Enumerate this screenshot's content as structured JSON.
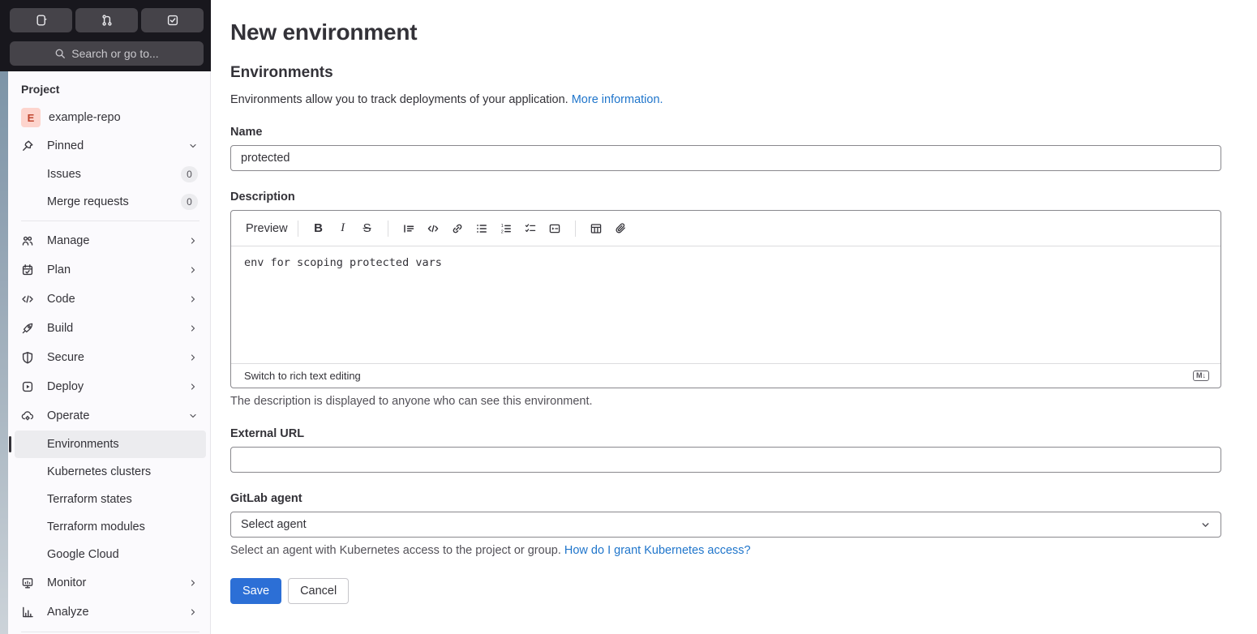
{
  "sidebar": {
    "search_placeholder": "Search or go to...",
    "section_label": "Project",
    "project": {
      "avatar_letter": "E",
      "name": "example-repo"
    },
    "items": [
      {
        "label": "Pinned"
      },
      {
        "label": "Issues",
        "badge": "0"
      },
      {
        "label": "Merge requests",
        "badge": "0"
      },
      {
        "label": "Manage"
      },
      {
        "label": "Plan"
      },
      {
        "label": "Code"
      },
      {
        "label": "Build"
      },
      {
        "label": "Secure"
      },
      {
        "label": "Deploy"
      },
      {
        "label": "Operate"
      },
      {
        "label": "Environments",
        "active": true
      },
      {
        "label": "Kubernetes clusters"
      },
      {
        "label": "Terraform states"
      },
      {
        "label": "Terraform modules"
      },
      {
        "label": "Google Cloud"
      },
      {
        "label": "Monitor"
      },
      {
        "label": "Analyze"
      }
    ]
  },
  "main": {
    "title": "New environment",
    "section_title": "Environments",
    "intro_text": "Environments allow you to track deployments of your application. ",
    "intro_link": "More information.",
    "name_field": {
      "label": "Name",
      "value": "protected"
    },
    "description": {
      "label": "Description",
      "toolbar": {
        "preview": "Preview",
        "bold_glyph": "B",
        "italic_glyph": "I",
        "strike_glyph": "S"
      },
      "value": "env for scoping protected vars",
      "footer_link": "Switch to rich text editing",
      "markdown_icon_label": "M↓",
      "helper": "The description is displayed to anyone who can see this environment."
    },
    "external_url": {
      "label": "External URL",
      "value": ""
    },
    "agent": {
      "label": "GitLab agent",
      "selected": "Select agent",
      "helper_text": "Select an agent with Kubernetes access to the project or group. ",
      "helper_link": "How do I grant Kubernetes access?"
    },
    "buttons": {
      "save": "Save",
      "cancel": "Cancel"
    }
  },
  "colors": {
    "link": "#1f75cb",
    "save_button": "#2c6fd6",
    "sidebar_header_bg": "#18171d",
    "sidebar_control_bg": "#454349",
    "sidebar_bg": "#fbfafd",
    "active_item_bg": "#ececef",
    "avatar_bg": "#fdd4cd",
    "avatar_text": "#c0452e"
  }
}
